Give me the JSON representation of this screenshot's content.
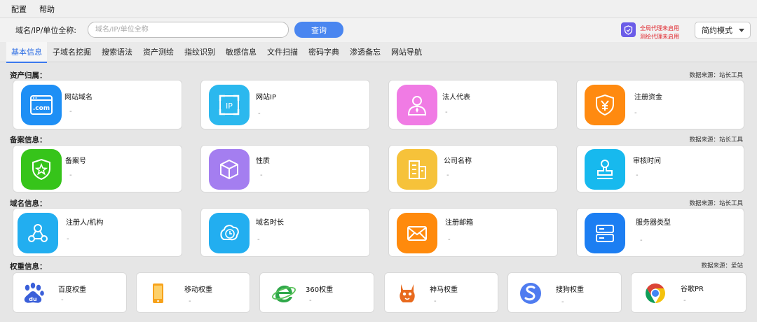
{
  "menubar": {
    "items": [
      "配置",
      "帮助"
    ]
  },
  "toolbar": {
    "label": "域名/IP/单位全称:",
    "search_placeholder": "域名/IP/单位全称",
    "query_label": "查询",
    "proxy_line1": "全局代理未启用",
    "proxy_line2": "测绘代理未启用",
    "mode_label": "简约模式"
  },
  "tabs": [
    "基本信息",
    "子域名挖掘",
    "搜索语法",
    "资产测绘",
    "指纹识别",
    "敏感信息",
    "文件扫描",
    "密码字典",
    "渗透备忘",
    "网站导航"
  ],
  "sections": [
    {
      "title": "资产归属：",
      "source": "数据来源：站长工具",
      "cards": [
        {
          "label": "网站域名",
          "value": "-",
          "color": "#1e8ff5",
          "icon": "com-icon"
        },
        {
          "label": "网站IP",
          "value": "-",
          "color": "#2bb8ee",
          "icon": "ip-icon"
        },
        {
          "label": "法人代表",
          "value": "-",
          "color": "#f07be4",
          "icon": "person-icon"
        },
        {
          "label": "注册资金",
          "value": "-",
          "color": "#ff8a10",
          "icon": "yuan-shield-icon"
        }
      ]
    },
    {
      "title": "备案信息：",
      "source": "数据来源：站长工具",
      "cards": [
        {
          "label": "备案号",
          "value": "-",
          "color": "#36c41a",
          "icon": "star-shield-icon"
        },
        {
          "label": "性质",
          "value": "-",
          "color": "#a47ef0",
          "icon": "cube-icon"
        },
        {
          "label": "公司名称",
          "value": "-",
          "color": "#f6c23a",
          "icon": "building-icon"
        },
        {
          "label": "审核时间",
          "value": "-",
          "color": "#17b9ee",
          "icon": "stamp-icon"
        }
      ]
    },
    {
      "title": "域名信息：",
      "source": "数据来源：站长工具",
      "cards": [
        {
          "label": "注册人/机构",
          "value": "-",
          "color": "#22aef0",
          "icon": "network-icon"
        },
        {
          "label": "域名时长",
          "value": "-",
          "color": "#22aef0",
          "icon": "clock-icon"
        },
        {
          "label": "注册邮箱",
          "value": "-",
          "color": "#ff8a0c",
          "icon": "mail-icon"
        },
        {
          "label": "服务器类型",
          "value": "-",
          "color": "#1c7ef2",
          "icon": "server-icon"
        }
      ]
    },
    {
      "title": "权重信息：",
      "source": "数据来源：爱站",
      "cards": [
        {
          "label": "百度权重",
          "value": "-",
          "icon": "baidu-icon"
        },
        {
          "label": "移动权重",
          "value": "-",
          "icon": "mobile-icon"
        },
        {
          "label": "360权重",
          "value": "-",
          "icon": "ie-360-icon"
        },
        {
          "label": "神马权重",
          "value": "-",
          "icon": "shenma-icon"
        },
        {
          "label": "搜狗权重",
          "value": "-",
          "icon": "sogou-icon"
        },
        {
          "label": "谷歌PR",
          "value": "-",
          "icon": "chrome-icon"
        }
      ]
    }
  ]
}
